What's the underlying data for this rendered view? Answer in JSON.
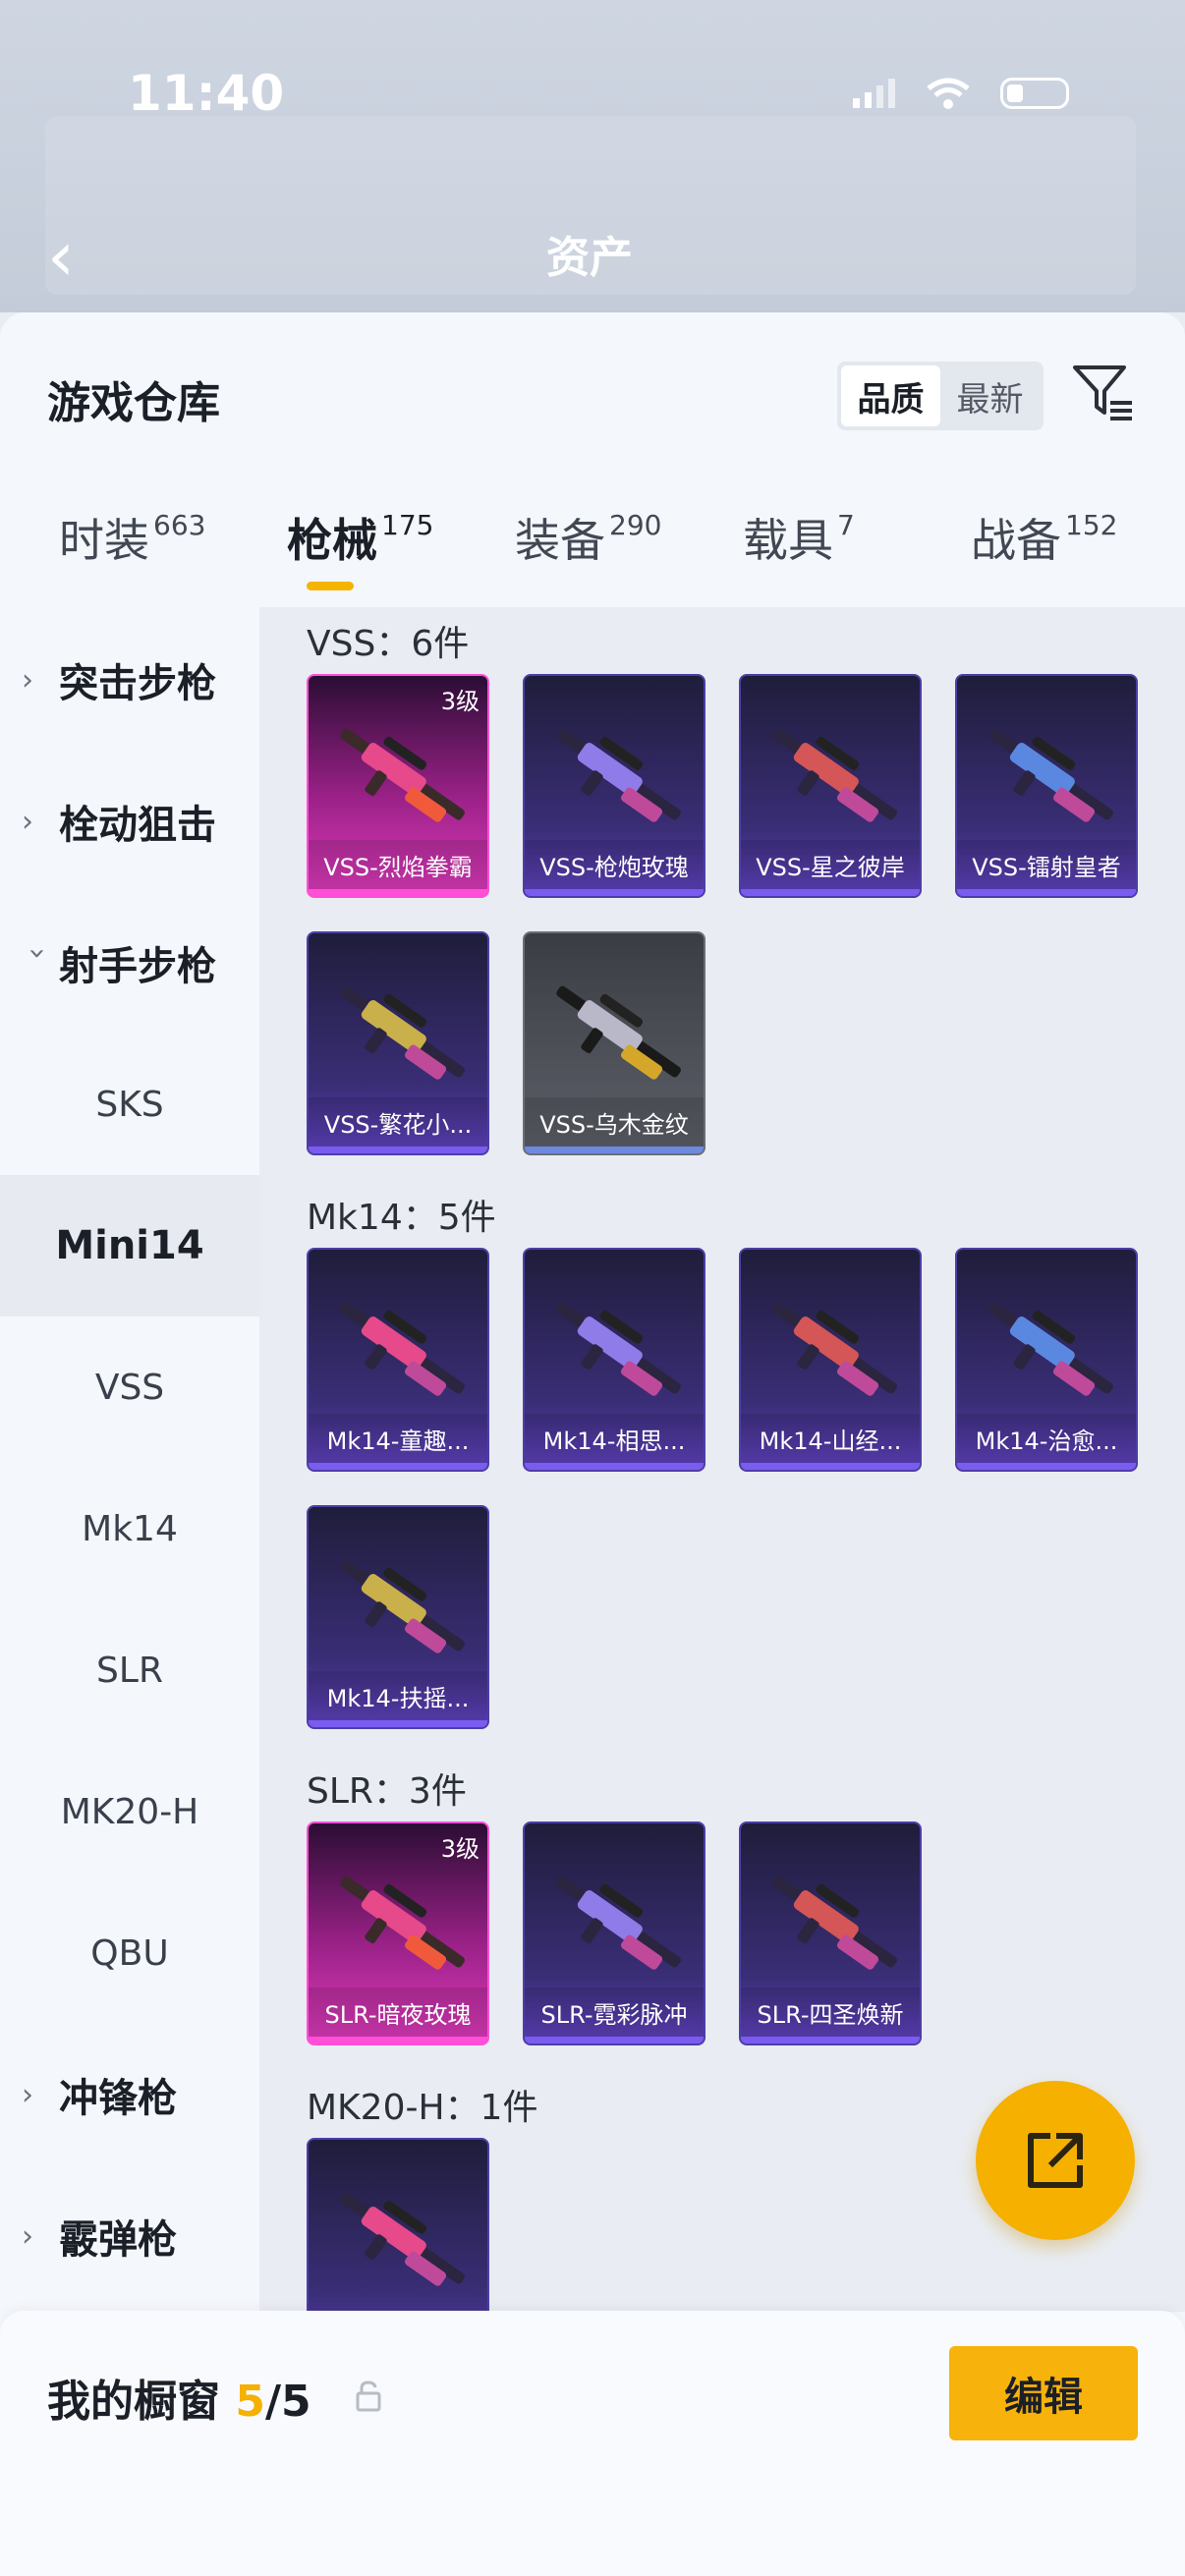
{
  "status_bar": {
    "time": "11:40"
  },
  "background_header": {
    "title": "资产"
  },
  "sheet": {
    "title": "游戏仓库",
    "sort_options": [
      "品质",
      "最新"
    ],
    "sort_selected": "品质"
  },
  "tabs": [
    {
      "name": "时装",
      "count": "663"
    },
    {
      "name": "枪械",
      "count": "175",
      "active": true
    },
    {
      "name": "装备",
      "count": "290"
    },
    {
      "name": "载具",
      "count": "7"
    },
    {
      "name": "战备",
      "count": "152"
    }
  ],
  "sidebar": {
    "cat_assault": "突击步枪",
    "cat_bolt": "栓动狙击",
    "cat_marksman": "射手步枪",
    "sub_sks": "SKS",
    "sub_mini14": "Mini14",
    "sub_vss": "VSS",
    "sub_mk14": "Mk14",
    "sub_slr": "SLR",
    "sub_mk20h": "MK20-H",
    "sub_qbu": "QBU",
    "cat_smg": "冲锋枪",
    "cat_shotgun": "霰弹枪"
  },
  "groups": {
    "vss": {
      "title": "VSS：6件",
      "items": [
        {
          "name": "VSS-烈焰拳霸",
          "level": "3级",
          "rarity": "pink"
        },
        {
          "name": "VSS-枪炮玫瑰",
          "rarity": "purple"
        },
        {
          "name": "VSS-星之彼岸",
          "rarity": "purple"
        },
        {
          "name": "VSS-镭射皇者",
          "rarity": "purple"
        },
        {
          "name": "VSS-繁花小...",
          "rarity": "purple"
        },
        {
          "name": "VSS-乌木金纹",
          "rarity": "gray"
        }
      ]
    },
    "mk14": {
      "title": "Mk14：5件",
      "items": [
        {
          "name": "Mk14-童趣...",
          "rarity": "purple"
        },
        {
          "name": "Mk14-相思...",
          "rarity": "purple"
        },
        {
          "name": "Mk14-山经...",
          "rarity": "purple"
        },
        {
          "name": "Mk14-治愈...",
          "rarity": "purple"
        },
        {
          "name": "Mk14-扶摇...",
          "rarity": "purple"
        }
      ]
    },
    "slr": {
      "title": "SLR：3件",
      "items": [
        {
          "name": "SLR-暗夜玫瑰",
          "level": "3级",
          "rarity": "pink"
        },
        {
          "name": "SLR-霓彩脉冲",
          "rarity": "purple"
        },
        {
          "name": "SLR-四圣焕新",
          "rarity": "purple"
        }
      ]
    },
    "mk20h": {
      "title": "MK20-H：1件",
      "items": [
        {
          "name": "",
          "rarity": "purple"
        }
      ]
    }
  },
  "showcase": {
    "label": "我的橱窗",
    "current": "5",
    "separator": "/",
    "total": "5"
  },
  "edit_button": "编辑",
  "colors": {
    "accent": "#f5b000",
    "purple_card": "#3a2e77",
    "pink_card": "#e03cbd"
  }
}
